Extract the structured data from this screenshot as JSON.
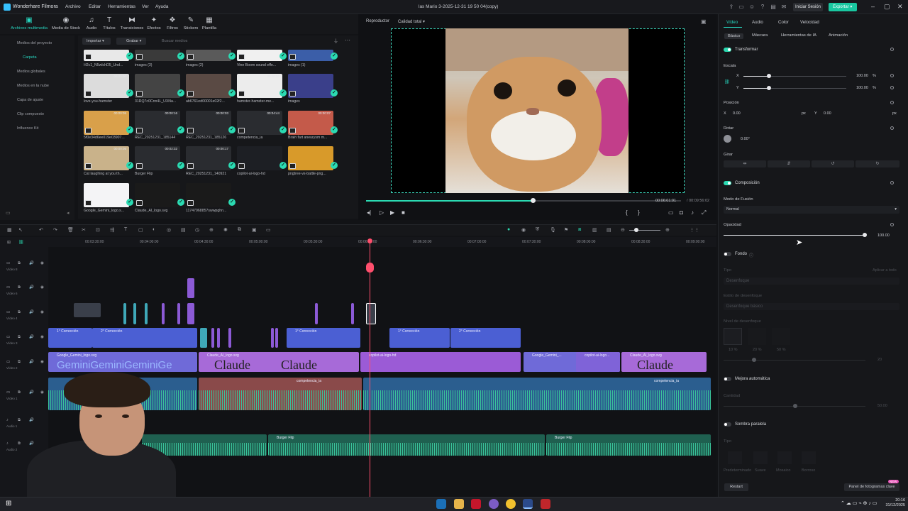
{
  "app": {
    "name": "Wonderhare Filmora",
    "document_title": "las Mario 3-2025-12-31 19 50 04(copy)",
    "signin_label": "Iniciar Sesión",
    "export_label": "Exportar"
  },
  "menu": [
    "Archivo",
    "Editar",
    "Herramientas",
    "Ver",
    "Ayuda"
  ],
  "media_toolbar": [
    {
      "label": "Archivos multimedia",
      "icon": "media-folder-icon"
    },
    {
      "label": "Media de Stock",
      "icon": "stock-icon"
    },
    {
      "label": "Audio",
      "icon": "music-note-icon"
    },
    {
      "label": "Títulos",
      "icon": "title-t-icon"
    },
    {
      "label": "Transiciones",
      "icon": "transition-icon"
    },
    {
      "label": "Efectos",
      "icon": "effects-icon"
    },
    {
      "label": "Filtros",
      "icon": "filter-icon"
    },
    {
      "label": "Stickers",
      "icon": "sticker-icon"
    },
    {
      "label": "Plantilla",
      "icon": "template-icon"
    }
  ],
  "sidebar": {
    "items": [
      "Medios del proyecto",
      "Carpeta",
      "Medios globales",
      "Medios en la nube",
      "Capa de ajuste",
      "Clip compuesto",
      "Influence Kit"
    ]
  },
  "media_panel": {
    "import_label": "Importar",
    "record_label": "Grabar",
    "search_placeholder": "Buscar medios"
  },
  "media_items": [
    {
      "caption": "H2c1_N5wlchD5_Und..."
    },
    {
      "caption": "images (3)"
    },
    {
      "caption": "images (2)"
    },
    {
      "caption": "Vine Boom sound effe..."
    },
    {
      "caption": "images (1)"
    },
    {
      "caption": "love-you-hamster",
      "duration": "00:00:00"
    },
    {
      "caption": "31RQ7c0Cnn4L_UXNa..."
    },
    {
      "caption": "ab6761ed00001e02f2..."
    },
    {
      "caption": "hamster-hamster-me...",
      "duration": "00:00:03"
    },
    {
      "caption": "images"
    },
    {
      "caption": "5f0e34d6ee019e03907...",
      "duration": "00:00:05"
    },
    {
      "caption": "REC_20251231_185144",
      "duration": "00:00:16"
    },
    {
      "caption": "REC_20251231_185126",
      "duration": "00:00:03"
    },
    {
      "caption": "competencia_ia",
      "duration": "00:04:44"
    },
    {
      "caption": "Brain fart aneurysm m...",
      "duration": "00:00:07"
    },
    {
      "caption": "Cat laughing at you th...",
      "duration": "00:00:05"
    },
    {
      "caption": "Burger Flip",
      "duration": "00:02:32"
    },
    {
      "caption": "REC_20251231_140921",
      "duration": "00:00:17"
    },
    {
      "caption": "copilot-ai-logo-hd"
    },
    {
      "caption": "pngtree-vs-battle-png..."
    },
    {
      "caption": "Google_Gemini_logo.s..."
    },
    {
      "caption": "Claude_AI_logo.svg"
    },
    {
      "caption": "11747968857swwpghn..."
    }
  ],
  "player": {
    "label": "Reproductor",
    "quality": "Calidad total",
    "current_time": "00:06:01:01",
    "total_time": "00:09:56:02",
    "progress": 0.53
  },
  "properties": {
    "tabs": [
      "Vídeo",
      "Audio",
      "Color",
      "Velocidad"
    ],
    "subtabs": [
      "Básico",
      "Máscara",
      "Herramientas de IA",
      "Animación"
    ],
    "transform": "Transformar",
    "scale": "Escala",
    "scale_x_label": "X",
    "scale_y_label": "Y",
    "scale_x": "100.00",
    "scale_y": "100.00",
    "percent": "%",
    "position": "Posición",
    "pos_x_label": "X",
    "pos_y_label": "Y",
    "pos_x": "0.00",
    "pos_y": "0.00",
    "px": "px",
    "rotate": "Rotar",
    "rotate_value": "0.00°",
    "flip": "Girar",
    "composition": "Composición",
    "blend_mode": "Modo de Fusión",
    "blend_value": "Normal",
    "opacity": "Opacidad",
    "opacity_value": "100.00",
    "background": "Fondo",
    "type_label": "Tipo",
    "apply_all": "Aplicar a todo",
    "blur_label": "Desenfoque",
    "blur_style": "Estilo de desenfoque",
    "blur_style_value": "Desenfoque básico",
    "blur_level": "Nivel de desenfoque",
    "blur_level_value": "20",
    "blur_pct": [
      "10 %",
      "20 %",
      "50 %"
    ],
    "auto_enhance": "Mejora automática",
    "quantity": "Cantidad",
    "quantity_value": "50.00",
    "shadow": "Sombra paralela",
    "shadow_type": "Tipo",
    "shadow_options": [
      "Predeterminado",
      "Suave",
      "Mosaico",
      "Borroso"
    ],
    "reset": "Restart",
    "keyframe_panel": "Panel de fotogramas clave",
    "new_badge": "NEW"
  },
  "timeline": {
    "ruler": [
      "00:03:30:00",
      "00:04:00:00",
      "00:04:30:00",
      "00:05:00:00",
      "00:05:30:00",
      "00:06:00:00",
      "00:06:30:00",
      "00:07:00:00",
      "00:07:30:00",
      "00:08:00:00",
      "00:08:30:00",
      "00:09:00:00"
    ],
    "tracks": [
      "Vídeo 8",
      "Vídeo 6",
      "Vídeo 4",
      "Vídeo 3",
      "Vídeo 2",
      "Vídeo 1",
      "Audio 1",
      "Audio 2"
    ],
    "clips": {
      "correction1": "1° Corrección",
      "correction2": "2° Corrección",
      "gemini": "Google_Gemini_logo.svg",
      "claude": "Claude_AI_logo.svg",
      "copilot": "copilot-ai-logo-hd",
      "gemini_short": "Google_Gemini_...",
      "copilot_short": "copilot-ai-logo...",
      "competencia": "competencia_ia",
      "burger": "Burger Flip"
    },
    "overlay_text": {
      "gemini": "GeminiGeminiGeminiGe",
      "claude1": "Claude",
      "claude2": "Claude",
      "claude3": "Claude"
    }
  },
  "taskbar": {
    "time": "20:16",
    "date": "31/12/2025"
  },
  "colors": {
    "accent": "#27d7c0",
    "export": "#19c7a0",
    "playhead": "#ff4f6d",
    "purple_clip": "#8c5ad6",
    "blue_clip": "#4b5fd3"
  }
}
